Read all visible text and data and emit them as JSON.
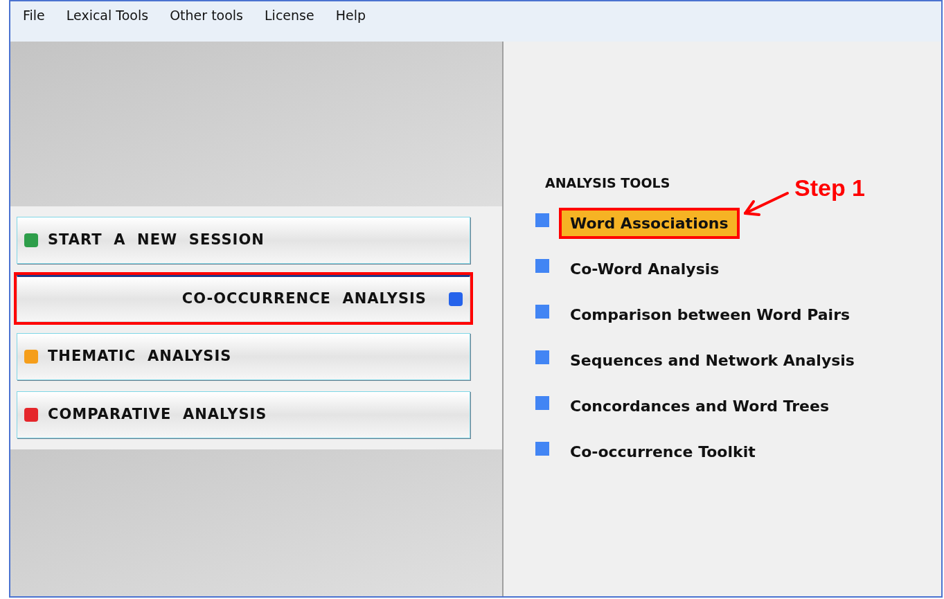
{
  "menu": [
    "File",
    "Lexical Tools",
    "Other tools",
    "License",
    "Help"
  ],
  "sessions": [
    {
      "label": "START  A  NEW  SESSION",
      "color": "#2e9e4a",
      "selected": false,
      "marked": false
    },
    {
      "label": "CO-OCCURRENCE  ANALYSIS",
      "color": "#2563eb",
      "selected": true,
      "marked": true
    },
    {
      "label": "THEMATIC  ANALYSIS",
      "color": "#f59e1b",
      "selected": false,
      "marked": false
    },
    {
      "label": "COMPARATIVE  ANALYSIS",
      "color": "#e5262b",
      "selected": false,
      "marked": false
    }
  ],
  "tools": {
    "title": "ANALYSIS TOOLS",
    "items": [
      {
        "label": "Word Associations",
        "selected": true,
        "marked": true
      },
      {
        "label": "Co-Word Analysis",
        "selected": false,
        "marked": false
      },
      {
        "label": "Comparison between Word Pairs",
        "selected": false,
        "marked": false
      },
      {
        "label": "Sequences and Network Analysis",
        "selected": false,
        "marked": false
      },
      {
        "label": "Concordances and Word Trees",
        "selected": false,
        "marked": false
      },
      {
        "label": "Co-occurrence Toolkit",
        "selected": false,
        "marked": false
      }
    ]
  },
  "annotation": {
    "label": "Step 1"
  }
}
